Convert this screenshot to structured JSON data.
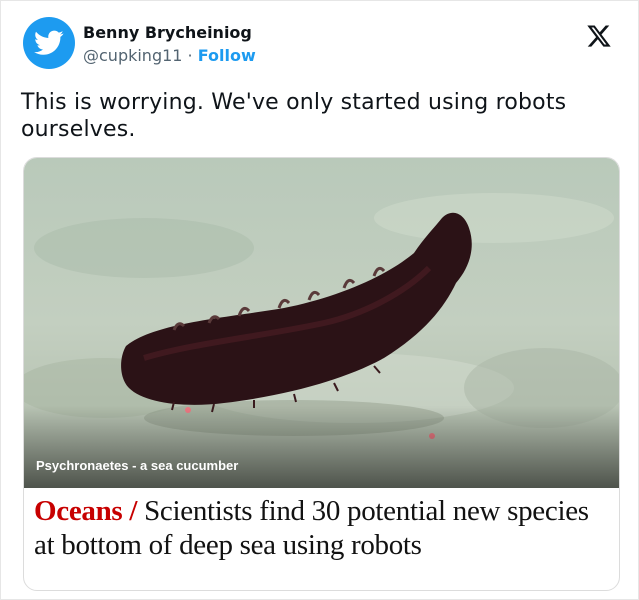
{
  "author": {
    "display_name": "Benny Brycheiniog",
    "handle": "@cupking11",
    "separator": " · ",
    "follow_label": "Follow"
  },
  "tweet": {
    "text": "This is worrying. We've only started using robots ourselves."
  },
  "media": {
    "caption": "Psychronaetes - a sea cucumber",
    "headline_kicker": "Oceans",
    "headline_slash": " / ",
    "headline": "Scientists find 30 potential new species at bottom of deep sea using robots"
  },
  "colors": {
    "accent": "#1d9bf0",
    "kicker": "#c70000"
  },
  "icons": {
    "avatar": "twitter-bird-icon",
    "platform": "x-logo-icon"
  }
}
